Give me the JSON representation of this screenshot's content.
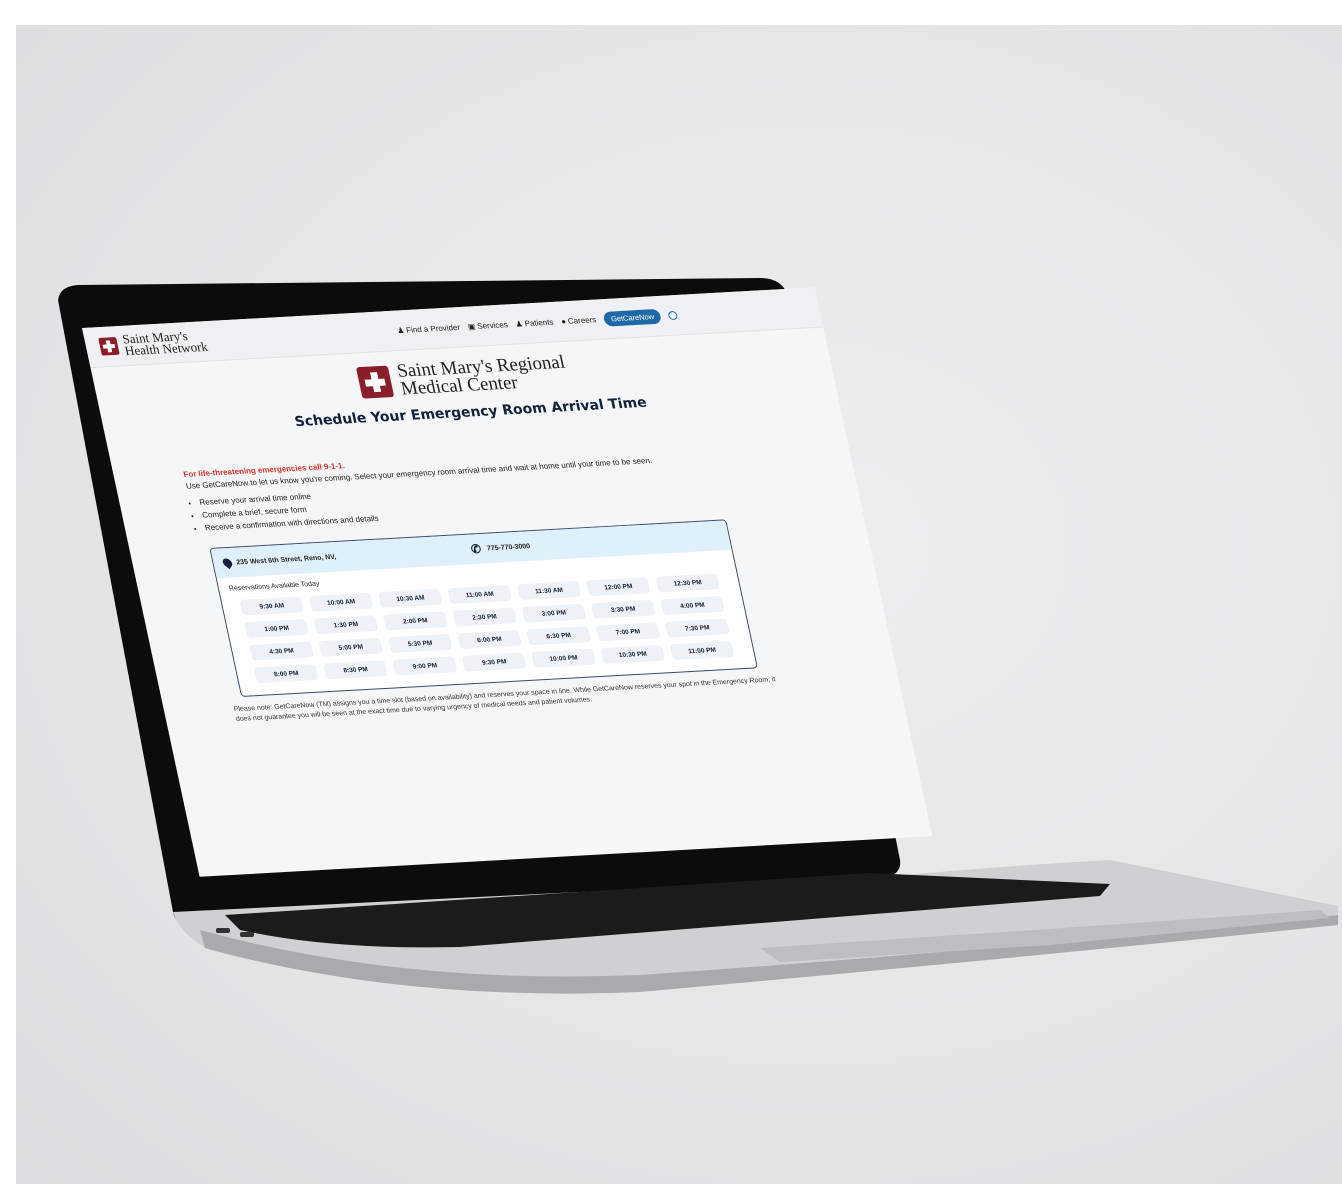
{
  "header": {
    "brand_name": "Saint Mary's\nHealth Network",
    "nav": [
      {
        "label": "Find a Provider",
        "icon": "provider-icon"
      },
      {
        "label": "Services",
        "icon": "services-icon"
      },
      {
        "label": "Patients",
        "icon": "patients-icon"
      },
      {
        "label": "Careers",
        "icon": "careers-icon"
      }
    ],
    "cta_label": "GetCareNow"
  },
  "hero": {
    "facility_name": "Saint Mary's Regional\nMedical Center",
    "title": "Schedule Your Emergency Room Arrival Time"
  },
  "content": {
    "warning": "For life-threatening emergencies call 9-1-1.",
    "intro": "Use GetCareNow to let us know you're coming. Select your emergency room arrival time and wait at home until your time to be seen.",
    "bullets": [
      "Reserve your arrival time online",
      "Complete a brief, secure form",
      "Receive a confirmation with directions and details"
    ]
  },
  "reservation_card": {
    "address": "235 West 6th Street, Reno, NV,",
    "phone": "775-770-3000",
    "availability_label": "Reservations Available Today",
    "slots": [
      "9:30 AM",
      "10:00 AM",
      "10:30 AM",
      "11:00 AM",
      "11:30 AM",
      "12:00 PM",
      "12:30 PM",
      "1:00 PM",
      "1:30 PM",
      "2:00 PM",
      "2:30 PM",
      "3:00 PM",
      "3:30 PM",
      "4:00 PM",
      "4:30 PM",
      "5:00 PM",
      "5:30 PM",
      "6:00 PM",
      "6:30 PM",
      "7:00 PM",
      "7:30 PM",
      "8:00 PM",
      "8:30 PM",
      "9:00 PM",
      "9:30 PM",
      "10:00 PM",
      "10:30 PM",
      "11:00 PM"
    ]
  },
  "note": "Please note: GetCareNow (TM) assigns you a time slot (based on availability) and reserves your space in line. While GetCareNow reserves your spot in the Emergency Room, it does not guarantee you will be seen at the exact time due to varying urgency of medical needs and patient volumes.",
  "colors": {
    "brand_red": "#8a1f2c",
    "accent_blue": "#1e6aa6",
    "warning_red": "#d6322c",
    "navy": "#15203a"
  }
}
